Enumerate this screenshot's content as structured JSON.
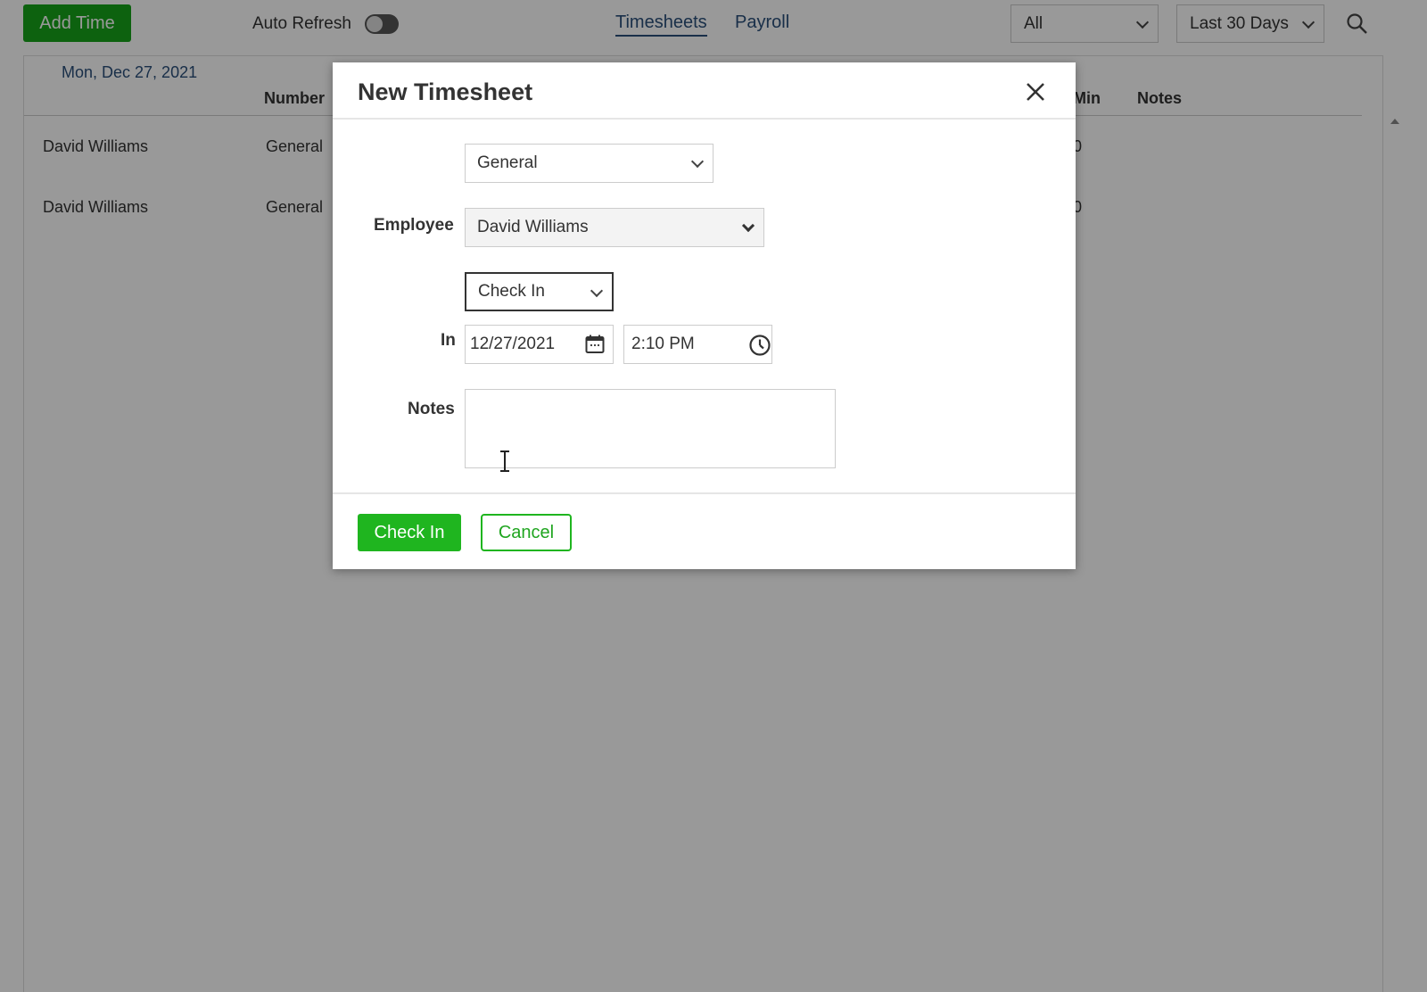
{
  "toolbar": {
    "add_time_label": "Add Time",
    "auto_refresh_label": "Auto Refresh",
    "auto_refresh_on": false,
    "tabs": [
      {
        "label": "Timesheets",
        "active": true
      },
      {
        "label": "Payroll",
        "active": false
      }
    ],
    "filter_value": "All",
    "range_value": "Last 30 Days"
  },
  "list": {
    "date_heading": "Mon, Dec 27, 2021",
    "columns": [
      "Number",
      "Min",
      "Notes"
    ],
    "rows": [
      {
        "name": "David Williams",
        "number": "General",
        "min": "0"
      },
      {
        "name": "David Williams",
        "number": "General",
        "min": "0"
      }
    ]
  },
  "modal": {
    "title": "New Timesheet",
    "type_value": "General",
    "employee_label": "Employee",
    "employee_value": "David Williams",
    "action_value": "Check In",
    "in_label": "In",
    "date_value": "12/27/2021",
    "time_value": "2:10 PM",
    "notes_label": "Notes",
    "notes_value": "",
    "check_in_button": "Check In",
    "cancel_button": "Cancel"
  },
  "colors": {
    "accent_green": "#1fb51f",
    "link_blue": "#2a4f7a"
  }
}
